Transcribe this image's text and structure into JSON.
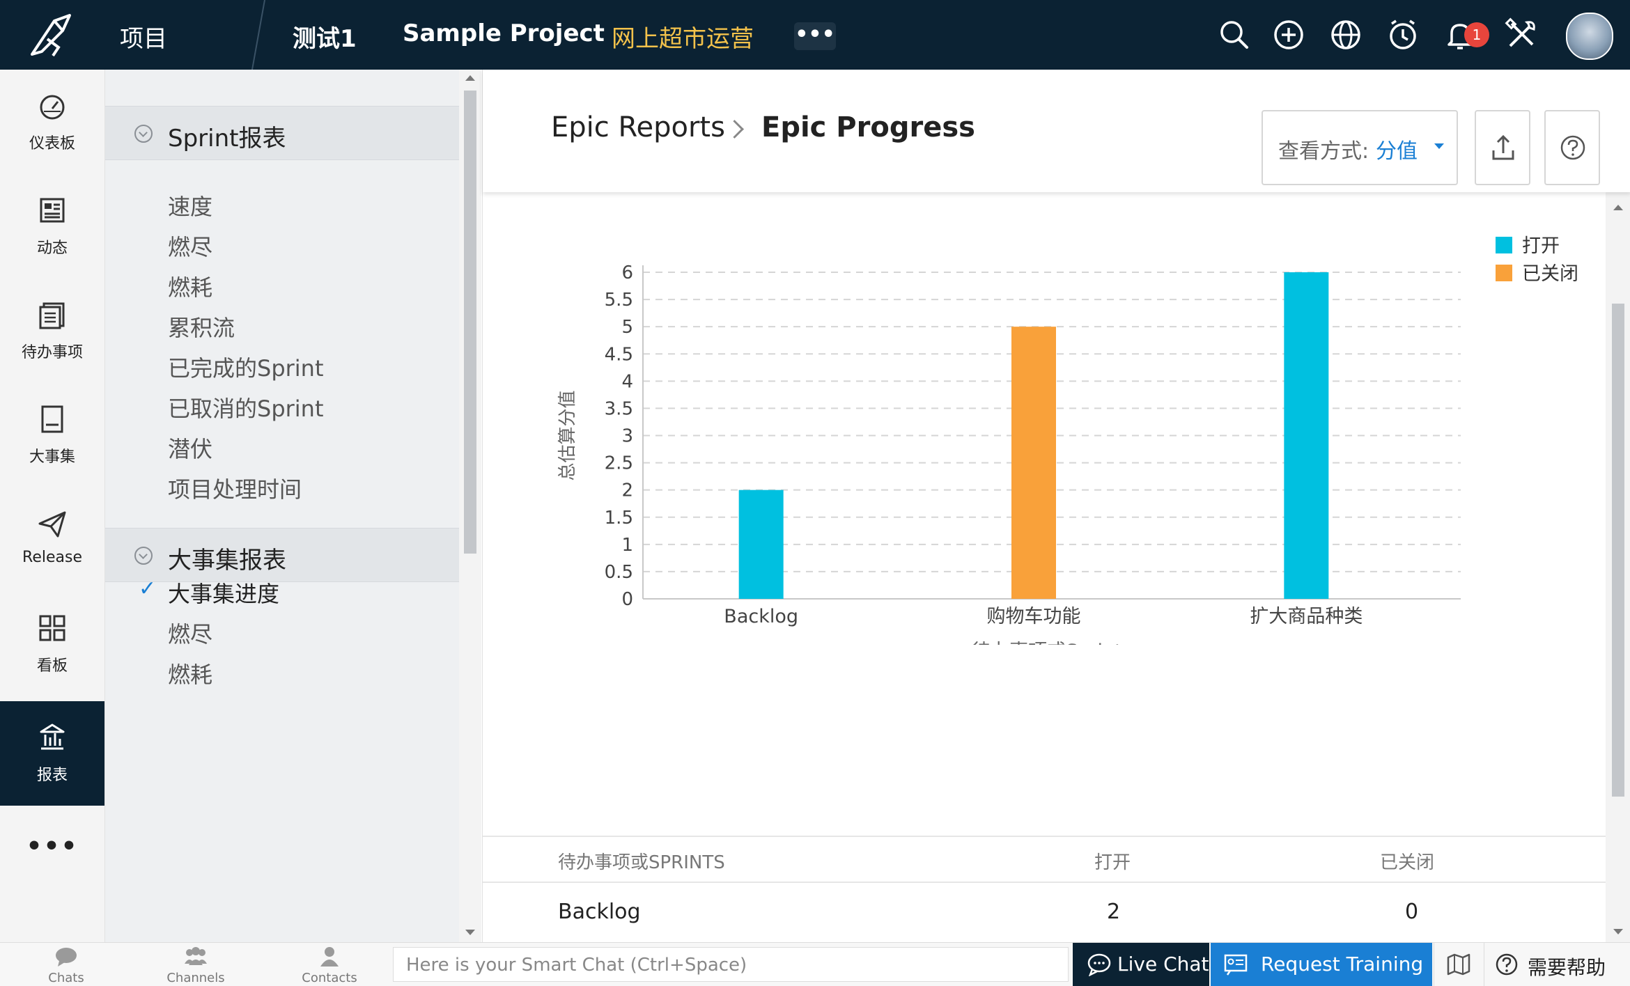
{
  "topbar": {
    "project_label": "项目",
    "crumbs": [
      "测试1",
      "Sample Project",
      "网上超市运营"
    ],
    "more": "•••",
    "notification_count": "1",
    "accent_color": "#f3c24b"
  },
  "leftnav": {
    "items": [
      {
        "label": "仪表板",
        "icon": "dashboard-icon"
      },
      {
        "label": "动态",
        "icon": "feed-icon"
      },
      {
        "label": "待办事项",
        "icon": "backlog-icon"
      },
      {
        "label": "大事集",
        "icon": "epic-icon"
      },
      {
        "label": "Release",
        "icon": "release-icon"
      },
      {
        "label": "看板",
        "icon": "board-icon"
      },
      {
        "label": "报表",
        "icon": "reports-icon",
        "active": true
      }
    ],
    "more": "•••"
  },
  "panel": {
    "sprint_section": "Sprint报表",
    "sprint_items": [
      "速度",
      "燃尽",
      "燃耗",
      "累积流",
      "已完成的Sprint",
      "已取消的Sprint",
      "潜伏",
      "项目处理时间"
    ],
    "epic_section": "大事集报表",
    "epic_items": [
      "大事集进度",
      "燃尽",
      "燃耗"
    ],
    "selected": "大事集进度"
  },
  "main": {
    "breadcrumb_parent": "Epic Reports",
    "breadcrumb_current": "Epic Progress",
    "view_label": "查看方式:",
    "view_value": "分值"
  },
  "chart_data": {
    "type": "bar",
    "categories": [
      "Backlog",
      "购物车功能",
      "扩大商品种类"
    ],
    "series": [
      {
        "name": "打开",
        "color": "#00c0e0",
        "values": [
          2,
          null,
          6
        ]
      },
      {
        "name": "已关闭",
        "color": "#f9a13a",
        "values": [
          null,
          5,
          null
        ]
      }
    ],
    "xlabel": "待办事项或Sprints",
    "ylabel": "总估算分值",
    "yticks": [
      "0",
      "0.5",
      "1",
      "1.5",
      "2",
      "2.5",
      "3",
      "3.5",
      "4",
      "4.5",
      "5",
      "5.5",
      "6"
    ],
    "ylim": [
      0,
      6
    ],
    "grid": true,
    "legend_position": "top-right"
  },
  "table": {
    "headers": [
      "待办事项或SPRINTS",
      "打开",
      "已关闭"
    ],
    "rows": [
      {
        "name": "Backlog",
        "open": "2",
        "closed": "0"
      }
    ]
  },
  "bottombar": {
    "tabs": [
      "Chats",
      "Channels",
      "Contacts"
    ],
    "smart_chat_placeholder": "Here is your Smart Chat (Ctrl+Space)",
    "live_chat": "Live Chat",
    "request_training": "Request Training",
    "help": "需要帮助",
    "live_chat_color": "#0b2233",
    "training_color": "#1a7fd4"
  }
}
